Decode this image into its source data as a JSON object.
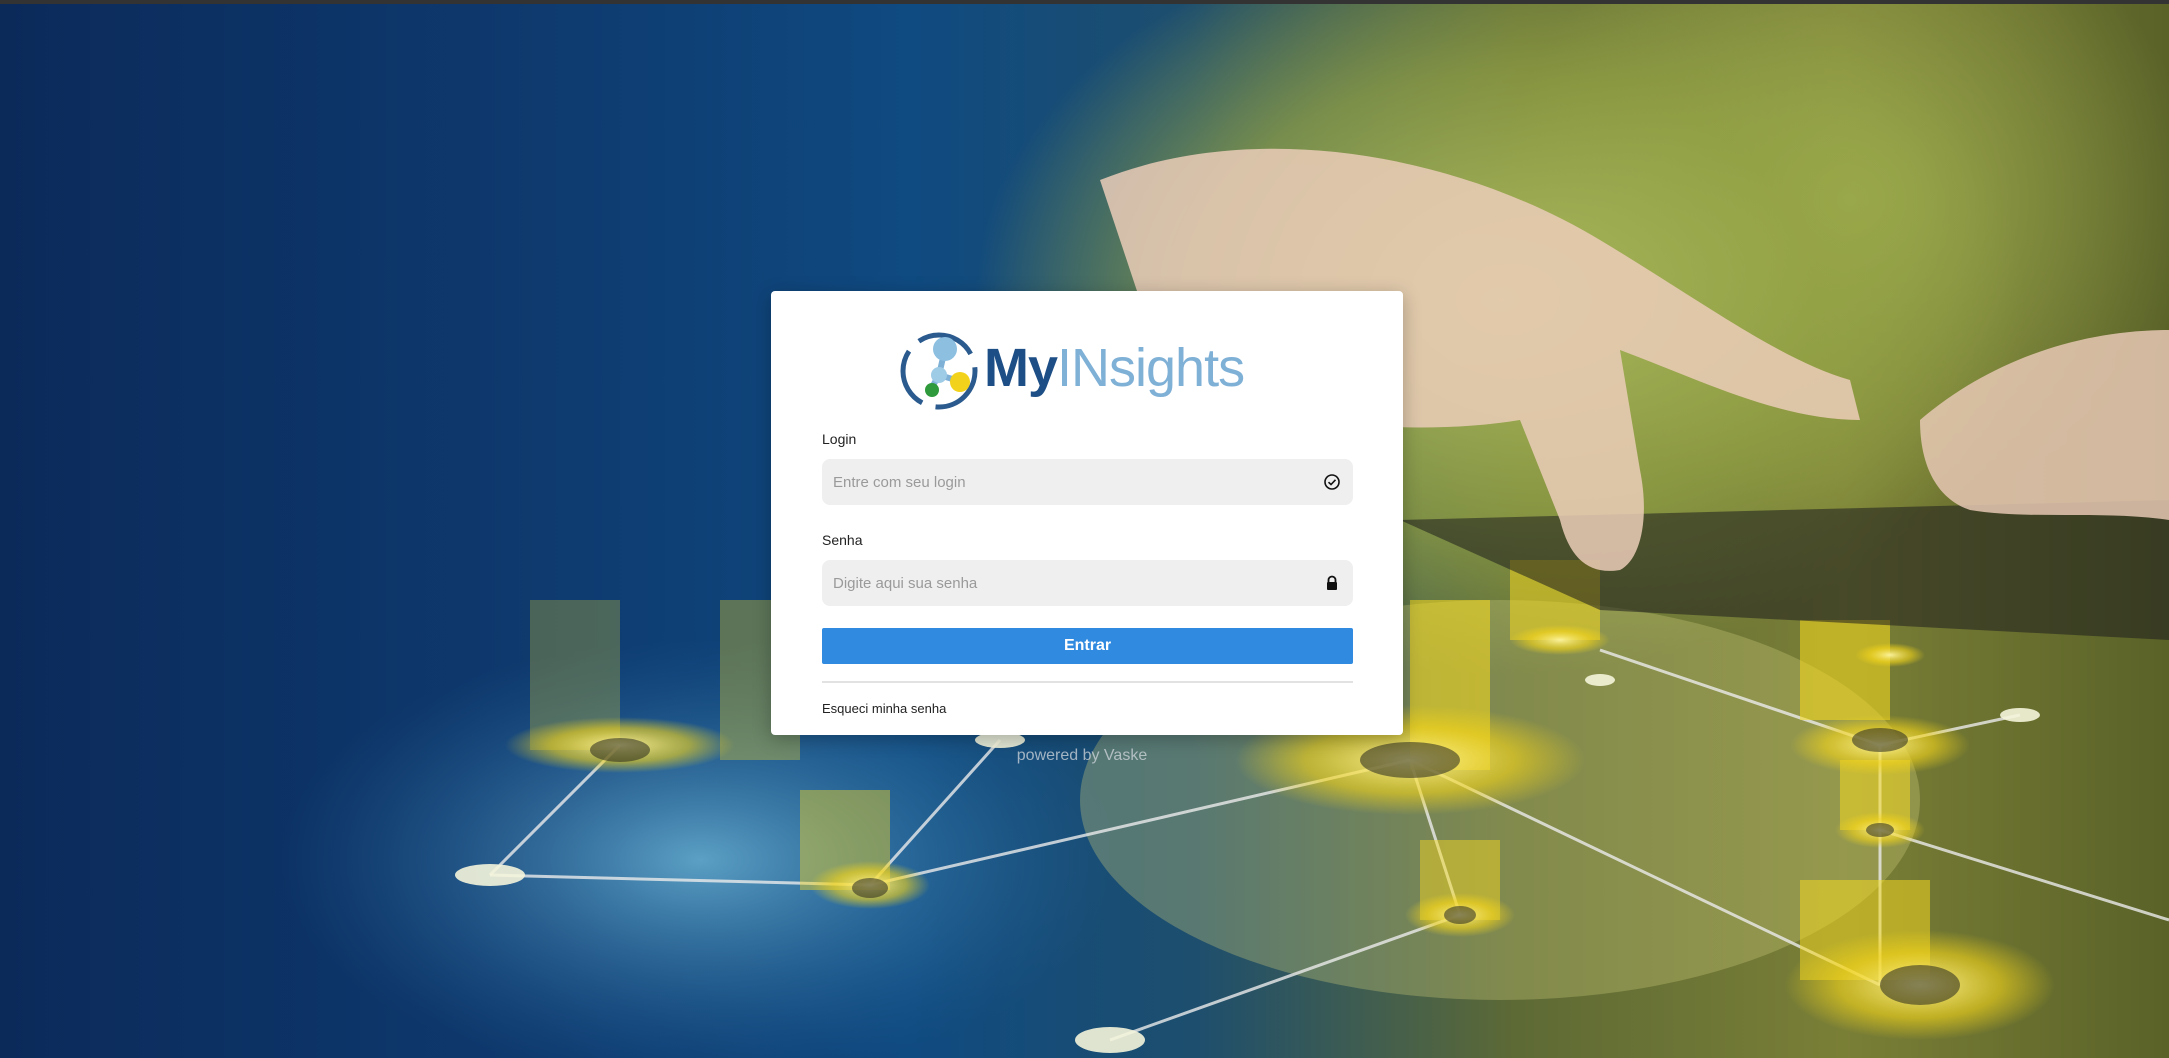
{
  "brand": {
    "logo_part1": "My",
    "logo_part2": "INsights",
    "logo_icon": "network-nodes-icon",
    "colors": {
      "primary": "#1d4e86",
      "secondary": "#7fb0d6",
      "button": "#2f8ae0"
    }
  },
  "login": {
    "label": "Login",
    "placeholder": "Entre com seu login",
    "icon": "check-circle-icon"
  },
  "password": {
    "label": "Senha",
    "placeholder": "Digite aqui sua senha",
    "icon": "lock-icon"
  },
  "submit_label": "Entrar",
  "forgot_label": "Esqueci minha senha",
  "footer": "powered by Vaske"
}
